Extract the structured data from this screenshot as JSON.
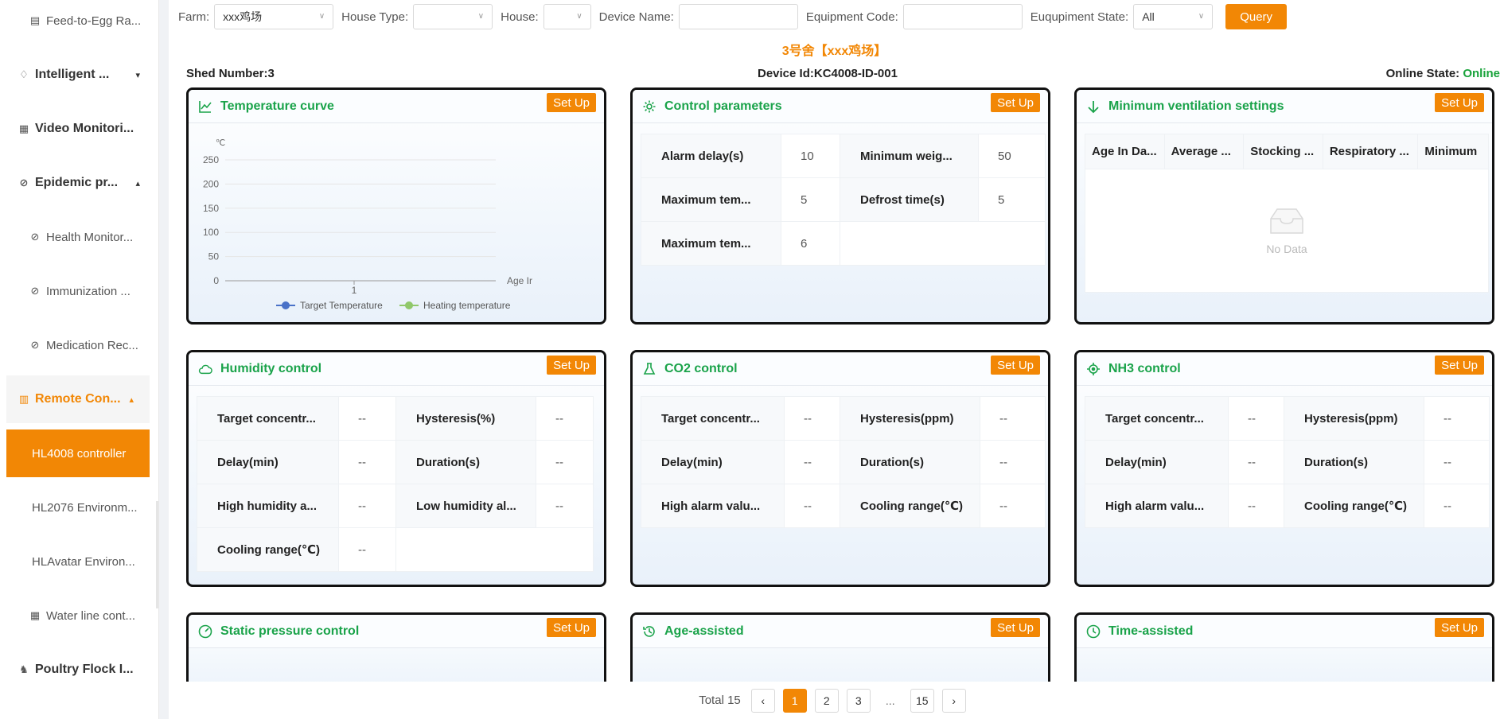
{
  "sidebar": {
    "items": [
      {
        "label": "Feed-to-Egg Ra..."
      },
      {
        "label": "Intelligent ..."
      },
      {
        "label": "Video Monitori..."
      },
      {
        "label": "Epidemic pr..."
      },
      {
        "label": "Health Monitor..."
      },
      {
        "label": "Immunization ..."
      },
      {
        "label": "Medication Rec..."
      },
      {
        "label": "Remote Con..."
      },
      {
        "label": "HL4008 controller"
      },
      {
        "label": "HL2076 Environm..."
      },
      {
        "label": "HLAvatar Environ..."
      },
      {
        "label": "Water line cont..."
      },
      {
        "label": "Poultry Flock I..."
      }
    ]
  },
  "filter": {
    "farm_label": "Farm:",
    "farm_value": "xxx鸡场",
    "house_type_label": "House Type:",
    "house_label": "House:",
    "device_name_label": "Device Name:",
    "equipment_code_label": "Equipment Code:",
    "equipment_state_label": "Euqupiment State:",
    "equipment_state_value": "All",
    "query_label": "Query"
  },
  "house_title": "3号舍【xxx鸡场】",
  "meta": {
    "shed": "Shed Number:3",
    "device": "Device Id:KC4008-ID-001",
    "online_label": "Online State:",
    "online_value": "Online"
  },
  "setup_label": "Set Up",
  "cards": {
    "temperature": {
      "title": "Temperature curve",
      "chart_data": {
        "type": "line",
        "ylabel": "℃",
        "xlabel": "Age Ir",
        "yticks": [
          "0",
          "50",
          "100",
          "150",
          "200",
          "250"
        ],
        "xticks": [
          "1"
        ],
        "ylim": [
          0,
          250
        ],
        "series": [
          {
            "name": "Target Temperature",
            "color": "#4a72c8",
            "values": []
          },
          {
            "name": "Heating temperature",
            "color": "#90c86a",
            "values": []
          }
        ],
        "legend_position": "bottom"
      }
    },
    "control": {
      "title": "Control parameters",
      "rows": [
        [
          "Alarm delay(s)",
          "10",
          "Minimum weig...",
          "50"
        ],
        [
          "Maximum tem...",
          "5",
          "Defrost time(s)",
          "5"
        ],
        [
          "Maximum tem...",
          "6",
          "",
          ""
        ]
      ]
    },
    "ventilation": {
      "title": "Minimum ventilation settings",
      "columns": [
        "Age In Da...",
        "Average ...",
        "Stocking ...",
        "Respiratory ...",
        "Minimum"
      ],
      "empty_text": "No Data"
    },
    "humidity": {
      "title": "Humidity control",
      "rows": [
        [
          "Target concentr...",
          "--",
          "Hysteresis(%)",
          "--"
        ],
        [
          "Delay(min)",
          "--",
          "Duration(s)",
          "--"
        ],
        [
          "High humidity a...",
          "--",
          "Low humidity al...",
          "--"
        ],
        [
          "Cooling range(℃)",
          "--",
          "",
          ""
        ]
      ]
    },
    "co2": {
      "title": "CO2 control",
      "rows": [
        [
          "Target concentr...",
          "--",
          "Hysteresis(ppm)",
          "--"
        ],
        [
          "Delay(min)",
          "--",
          "Duration(s)",
          "--"
        ],
        [
          "High alarm valu...",
          "--",
          "Cooling range(℃)",
          "--"
        ]
      ]
    },
    "nh3": {
      "title": "NH3 control",
      "rows": [
        [
          "Target concentr...",
          "--",
          "Hysteresis(ppm)",
          "--"
        ],
        [
          "Delay(min)",
          "--",
          "Duration(s)",
          "--"
        ],
        [
          "High alarm valu...",
          "--",
          "Cooling range(℃)",
          "--"
        ]
      ]
    },
    "pressure": {
      "title": "Static pressure control"
    },
    "age": {
      "title": "Age-assisted"
    },
    "time": {
      "title": "Time-assisted"
    }
  },
  "pager": {
    "total": "Total 15",
    "pages": [
      "1",
      "2",
      "3"
    ],
    "ellipsis": "...",
    "last": "15",
    "current": "1"
  },
  "colors": {
    "accent": "#f28705",
    "success": "#1aa34a"
  }
}
